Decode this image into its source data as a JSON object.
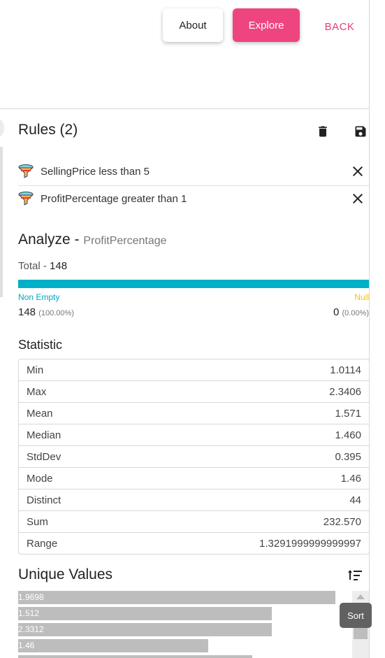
{
  "header": {
    "about_label": "About",
    "explore_label": "Explore",
    "back_label": "BACK"
  },
  "rules": {
    "title": "Rules (2)",
    "items": [
      {
        "label": "SellingPrice less than 5"
      },
      {
        "label": "ProfitPercentage greater than 1"
      }
    ]
  },
  "analyze": {
    "title": "Analyze -",
    "field": "ProfitPercentage",
    "total_label": "Total -",
    "total_value": "148",
    "non_empty_label": "Non Empty",
    "null_label": "Null",
    "non_empty_count": "148",
    "non_empty_pct": "(100.00%)",
    "null_count": "0",
    "null_pct": "(0.00%)",
    "non_empty_fraction": 1.0
  },
  "statistic": {
    "title": "Statistic",
    "rows": [
      {
        "name": "Min",
        "value": "1.0114"
      },
      {
        "name": "Max",
        "value": "2.3406"
      },
      {
        "name": "Mean",
        "value": "1.571"
      },
      {
        "name": "Median",
        "value": "1.460"
      },
      {
        "name": "StdDev",
        "value": "0.395"
      },
      {
        "name": "Mode",
        "value": "1.46"
      },
      {
        "name": "Distinct",
        "value": "44"
      },
      {
        "name": "Sum",
        "value": "232.570"
      },
      {
        "name": "Range",
        "value": "1.3291999999999997"
      }
    ]
  },
  "unique_values": {
    "title": "Unique Values",
    "tooltip": "Sort",
    "items": [
      {
        "label": "1.9698",
        "fraction": 0.95
      },
      {
        "label": "1.512",
        "fraction": 0.76
      },
      {
        "label": "2.3312",
        "fraction": 0.76
      },
      {
        "label": "1.46",
        "fraction": 0.57
      }
    ]
  },
  "colors": {
    "accent": "#ee4580",
    "bar": "#00b0c6",
    "null": "#f4c200"
  },
  "icons": [
    "trash-icon",
    "save-icon",
    "filter-icon",
    "close-icon",
    "sort-icon"
  ]
}
